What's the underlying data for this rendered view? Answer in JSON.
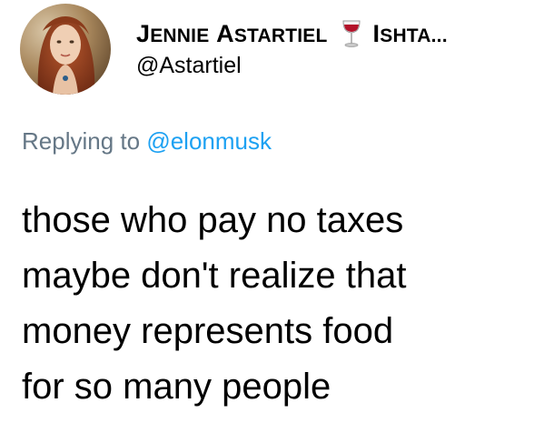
{
  "author": {
    "display_name_first_initial": "J",
    "display_name_first_rest": "ENNIE",
    "display_name_last_initial": "A",
    "display_name_last_rest": "STARTIEL",
    "display_name_second_initial": "I",
    "display_name_second_rest": "SHTA...",
    "handle": "@Astartiel",
    "emoji_icon": "wine-glass-icon"
  },
  "reply": {
    "prefix": "Replying to",
    "mention": "@elonmusk"
  },
  "tweet": {
    "lines": [
      "those who pay no taxes",
      "maybe don't realize that",
      "money represents food",
      "for so many people"
    ]
  },
  "colors": {
    "text": "#000000",
    "secondary_text": "#657786",
    "mention": "#1da1f2"
  }
}
